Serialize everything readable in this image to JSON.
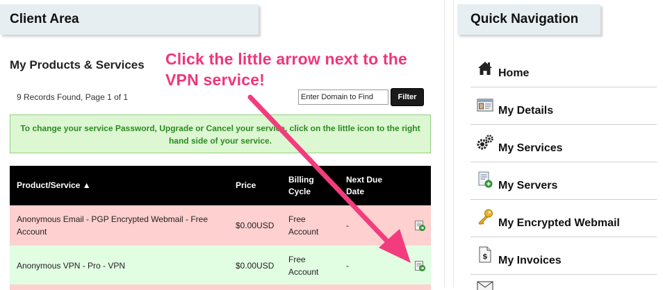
{
  "client_area": {
    "title": "Client Area",
    "section_title": "My Products & Services",
    "records_text": "9 Records Found, Page 1 of 1",
    "domain_search": {
      "value": "Enter Domain to Find"
    },
    "filter_label": "Filter",
    "info_message": "To change your service Password, Upgrade or Cancel your service, click on the little icon to the right hand side of your service.",
    "table": {
      "headers": [
        "Product/Service ▲",
        "Price",
        "Billing Cycle",
        "Next Due Date"
      ],
      "rows": [
        {
          "product": "Anonymous Email - PGP Encrypted Webmail - Free Account",
          "price": "$0.00USD",
          "billing_cycle": "Free Account",
          "next_due": "-"
        },
        {
          "product": "Anonymous VPN - Pro - VPN",
          "price": "$0.00USD",
          "billing_cycle": "Free Account",
          "next_due": "-"
        }
      ]
    }
  },
  "quick_nav": {
    "title": "Quick Navigation",
    "items": [
      {
        "label": "Home",
        "icon": "home-icon"
      },
      {
        "label": "My Details",
        "icon": "id-card-icon"
      },
      {
        "label": "My Services",
        "icon": "gears-icon"
      },
      {
        "label": "My Servers",
        "icon": "server-document-icon"
      },
      {
        "label": "My Encrypted Webmail",
        "icon": "key-icon"
      },
      {
        "label": "My Invoices",
        "icon": "invoice-dollar-icon"
      }
    ],
    "partial_item_icon": "envelope-icon"
  },
  "annotation": {
    "text": "Click the little arrow next to the VPN service!",
    "color": "#f0357a"
  },
  "colors": {
    "header_tab_bg": "#e6eef2",
    "info_box_bg": "#dcf7d2",
    "info_text": "#2d8a24",
    "row_pink": "#fed0cf",
    "row_green": "#e1fde2",
    "table_header_bg": "#000000"
  }
}
